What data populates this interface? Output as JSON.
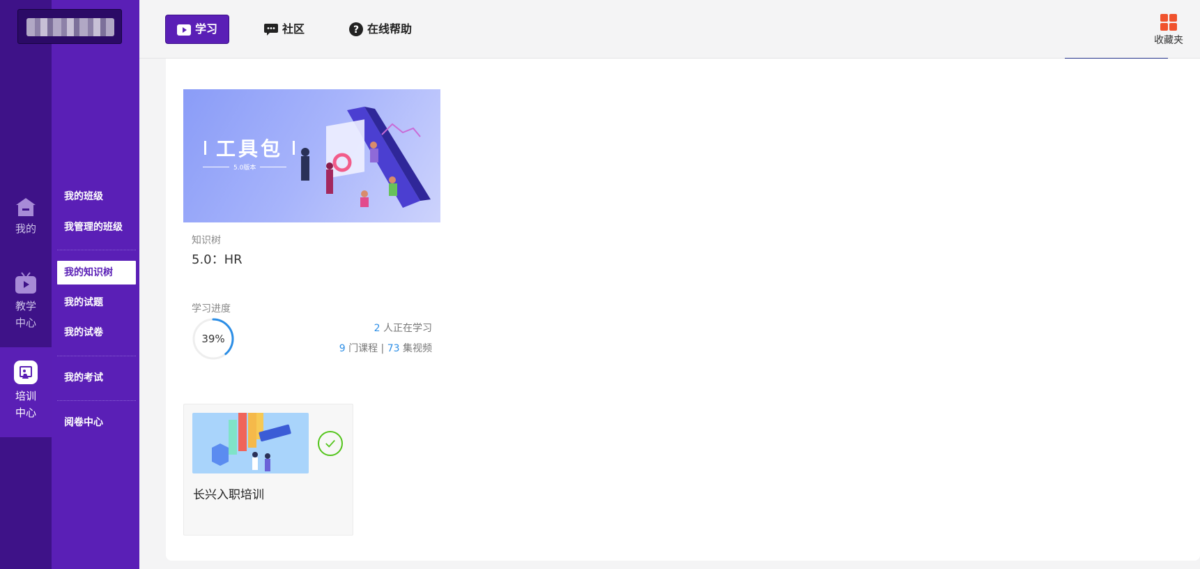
{
  "rail": {
    "items": [
      {
        "label": "我的",
        "icon": "home-icon"
      },
      {
        "label": "教学中心",
        "icon": "tv-play-icon"
      },
      {
        "label": "培训中心",
        "icon": "training-icon"
      }
    ]
  },
  "subnav": {
    "items": [
      "我的班级",
      "我管理的班级",
      "我的知识树",
      "我的试题",
      "我的试卷",
      "我的考试",
      "阅卷中心"
    ],
    "active_index": 2
  },
  "topbar": {
    "tabs": [
      {
        "label": "学习",
        "icon": "play-icon"
      },
      {
        "label": "社区",
        "icon": "chat-icon"
      },
      {
        "label": "在线帮助",
        "icon": "help-icon"
      }
    ],
    "favorites_label": "收藏夹"
  },
  "tree_card": {
    "banner_title": "工具包",
    "banner_subtitle": "5.0版本",
    "label": "知识树",
    "title": "5.0：HR",
    "progress_label": "学习进度",
    "progress_percent": 39,
    "progress_text": "39%",
    "learners_count": "2",
    "learners_text": "人正在学习",
    "course_count": "9",
    "course_unit": "门课程 |",
    "video_count": "73",
    "video_unit": "集视频"
  },
  "course": {
    "title": "长兴入职培训",
    "completed": true
  },
  "colors": {
    "rail": "#3e1288",
    "subnav": "#5a1fb6",
    "accent_blue": "#2c8ee6",
    "check_green": "#52c41a",
    "fav_orange": "#f0522d"
  }
}
